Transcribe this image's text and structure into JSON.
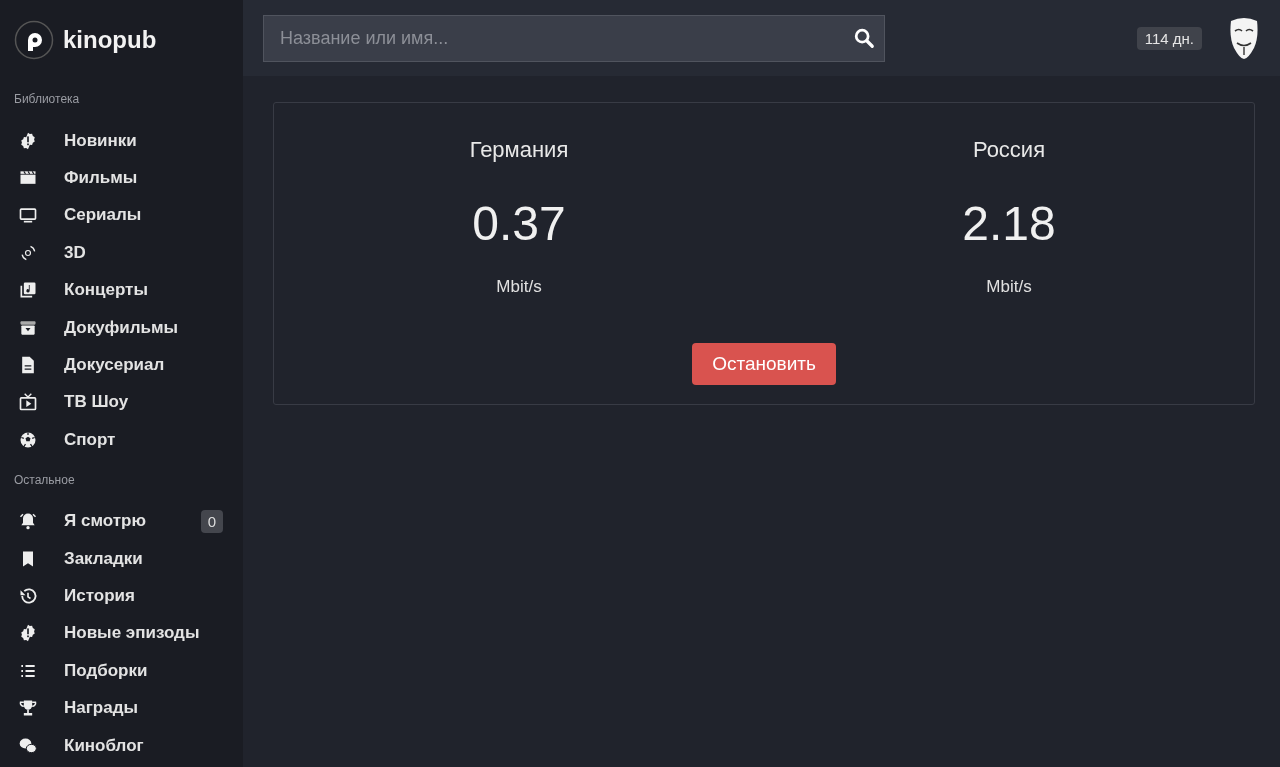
{
  "brand": {
    "name": "kinopub"
  },
  "sidebar": {
    "sections": [
      {
        "heading": "Библиотека",
        "items": [
          {
            "label": "Новинки"
          },
          {
            "label": "Фильмы"
          },
          {
            "label": "Сериалы"
          },
          {
            "label": "3D"
          },
          {
            "label": "Концерты"
          },
          {
            "label": "Докуфильмы"
          },
          {
            "label": "Докусериал"
          },
          {
            "label": "ТВ Шоу"
          },
          {
            "label": "Спорт"
          }
        ]
      },
      {
        "heading": "Остальное",
        "items": [
          {
            "label": "Я смотрю",
            "badge": "0"
          },
          {
            "label": "Закладки"
          },
          {
            "label": "История"
          },
          {
            "label": "Новые эпизоды"
          },
          {
            "label": "Подборки"
          },
          {
            "label": "Награды"
          },
          {
            "label": "Киноблог"
          }
        ]
      }
    ]
  },
  "search": {
    "placeholder": "Название или имя..."
  },
  "subscription_badge": "114 дн.",
  "speed_test": {
    "servers": [
      {
        "name": "Германия",
        "value": "0.37",
        "unit": "Mbit/s"
      },
      {
        "name": "Россия",
        "value": "2.18",
        "unit": "Mbit/s"
      }
    ],
    "button": "Остановить"
  }
}
